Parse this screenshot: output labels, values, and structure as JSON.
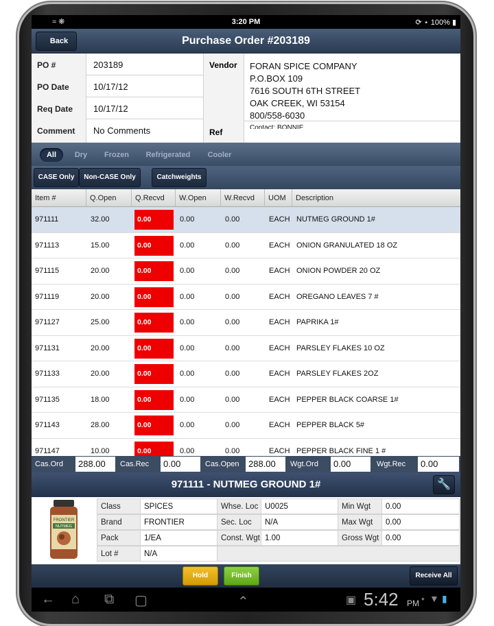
{
  "status_bar": {
    "time": "3:20 PM",
    "battery": "100%"
  },
  "nav": {
    "back_label": "Back",
    "title": "Purchase Order #203189"
  },
  "po": {
    "po_label": "PO #",
    "po_value": "203189",
    "date_label": "PO Date",
    "date_value": "10/17/12",
    "req_label": "Req Date",
    "req_value": "10/17/12",
    "comment_label": "Comment",
    "comment_value": "No Comments",
    "vendor_label": "Vendor",
    "ref_label": "Ref",
    "vendor_lines": [
      "FORAN SPICE COMPANY",
      "P.O.BOX 109",
      "7616 SOUTH 6TH STREET",
      "OAK CREEK, WI 53154",
      "800/558-6030",
      "Contact: BONNIE"
    ]
  },
  "filters": [
    "All",
    "Dry",
    "Frozen",
    "Refrigerated",
    "Cooler"
  ],
  "buttons": {
    "case_only": "CASE Only",
    "non_case_only": "Non-CASE Only",
    "catchweights": "Catchweights"
  },
  "columns": [
    "Item #",
    "Q.Open",
    "Q.Recvd",
    "W.Open",
    "W.Recvd",
    "UOM",
    "Description"
  ],
  "rows": [
    [
      "971111",
      "32.00",
      "0.00",
      "0.00",
      "0.00",
      "EACH",
      "NUTMEG GROUND 1#"
    ],
    [
      "971113",
      "15.00",
      "0.00",
      "0.00",
      "0.00",
      "EACH",
      "ONION GRANULATED 18 OZ"
    ],
    [
      "971115",
      "20.00",
      "0.00",
      "0.00",
      "0.00",
      "EACH",
      "ONION POWDER 20 OZ"
    ],
    [
      "971119",
      "20.00",
      "0.00",
      "0.00",
      "0.00",
      "EACH",
      "OREGANO LEAVES 7 #"
    ],
    [
      "971127",
      "25.00",
      "0.00",
      "0.00",
      "0.00",
      "EACH",
      "PAPRIKA 1#"
    ],
    [
      "971131",
      "20.00",
      "0.00",
      "0.00",
      "0.00",
      "EACH",
      "PARSLEY FLAKES 10 OZ"
    ],
    [
      "971133",
      "20.00",
      "0.00",
      "0.00",
      "0.00",
      "EACH",
      "PARSLEY FLAKES 2OZ"
    ],
    [
      "971135",
      "18.00",
      "0.00",
      "0.00",
      "0.00",
      "EACH",
      "PEPPER BLACK COARSE 1#"
    ],
    [
      "971143",
      "28.00",
      "0.00",
      "0.00",
      "0.00",
      "EACH",
      "PEPPER BLACK 5#"
    ],
    [
      "971147",
      "10.00",
      "0.00",
      "0.00",
      "0.00",
      "EACH",
      "PEPPER BLACK FINE 1 #"
    ]
  ],
  "totals": {
    "cas_ord_label": "Cas.Ord",
    "cas_ord": "288.00",
    "cas_rec_label": "Cas.Rec",
    "cas_rec": "0.00",
    "cas_open_label": "Cas.Open",
    "cas_open": "288.00",
    "wgt_ord_label": "Wgt.Ord",
    "wgt_ord": "0.00",
    "wgt_rec_label": "Wgt.Rec",
    "wgt_rec": "0.00"
  },
  "item": {
    "title": "971111 - NUTMEG GROUND 1#",
    "class_label": "Class",
    "class": "SPICES",
    "brand_label": "Brand",
    "brand": "FRONTIER",
    "pack_label": "Pack",
    "pack": "1/EA",
    "lot_label": "Lot #",
    "lot": "N/A",
    "whse_loc_label": "Whse. Loc",
    "whse_loc": "U0025",
    "sec_loc_label": "Sec. Loc",
    "sec_loc": "N/A",
    "const_wgt_label": "Const. Wgt",
    "const_wgt": "1.00",
    "min_wgt_label": "Min Wgt",
    "min_wgt": "0.00",
    "max_wgt_label": "Max Wgt",
    "max_wgt": "0.00",
    "gross_wgt_label": "Gross Wgt",
    "gross_wgt": "0.00",
    "jar_brand": "FRONTIER",
    "jar_product": "NUTMEG"
  },
  "footer": {
    "hold": "Hold",
    "finish": "Finish",
    "receive_all": "Receive All"
  },
  "system_bar": {
    "clock": "5:42",
    "ampm": "PM"
  },
  "colors": {
    "received_red": "#ee0000",
    "hold": "#e0a812",
    "finish": "#78bd2c",
    "nav": "#2a3b52"
  }
}
